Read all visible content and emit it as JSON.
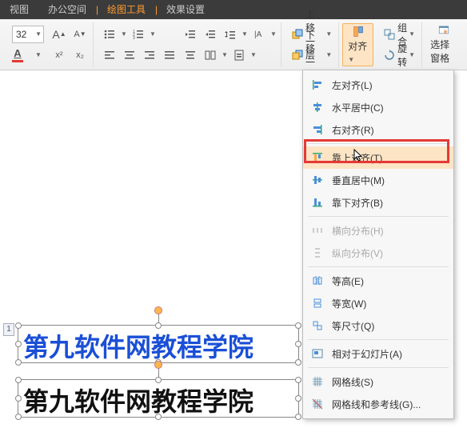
{
  "tabs": {
    "t1": "视图",
    "t2": "办公空间",
    "t3": "绘图工具",
    "t4": "效果设置"
  },
  "fontSize": "32",
  "ribbon": {
    "moveUp": "上移一层",
    "moveDown": "下移一层",
    "align": "对齐",
    "group": "组合",
    "rotate": "旋转",
    "selectPane": "选择窗格"
  },
  "slideNumber": "1",
  "text1": "第九软件网教程学院",
  "text2": "第九软件网教程学院",
  "menu": {
    "alignLeft": "左对齐(L)",
    "alignCenter": "水平居中(C)",
    "alignRight": "右对齐(R)",
    "alignTop": "靠上对齐(T)",
    "alignMid": "垂直居中(M)",
    "alignBottom": "靠下对齐(B)",
    "distH": "横向分布(H)",
    "distV": "纵向分布(V)",
    "eqH": "等高(E)",
    "eqW": "等宽(W)",
    "eqSize": "等尺寸(Q)",
    "relSlide": "相对于幻灯片(A)",
    "grid": "网格线(S)",
    "gridGuides": "网格线和参考线(G)..."
  },
  "colors": {
    "accent": "#ff9a2e",
    "highlight": "#fde4c4",
    "textBlue": "#1a4fd6"
  }
}
